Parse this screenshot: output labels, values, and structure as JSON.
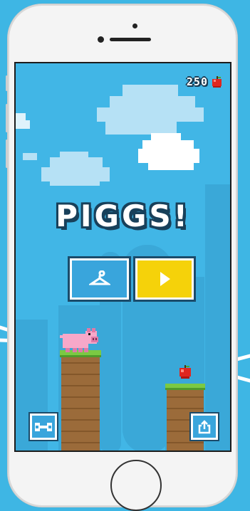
{
  "game": {
    "title": "PIGGS!",
    "score": "250"
  },
  "icons": {
    "score": "apple-icon",
    "outfit_button": "hanger-icon",
    "play_button": "play-icon",
    "settings_button": "wrench-icon",
    "share_button": "share-icon",
    "collectible": "apple-icon",
    "player": "pig-sprite"
  },
  "colors": {
    "sky": "#41b6e6",
    "play_button": "#f5d20a",
    "menu_button": "#39a5dc",
    "grass": "#7bc943",
    "dirt": "#9b6b3a"
  }
}
